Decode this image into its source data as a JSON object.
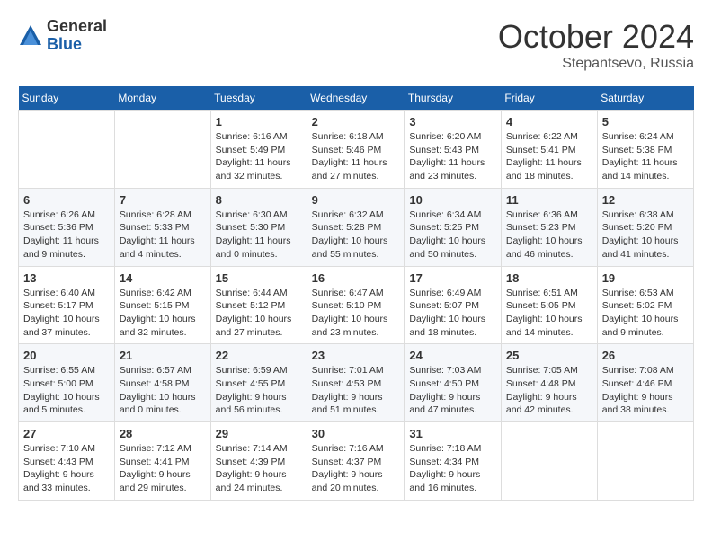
{
  "header": {
    "logo_general": "General",
    "logo_blue": "Blue",
    "month": "October 2024",
    "location": "Stepantsevo, Russia"
  },
  "days_of_week": [
    "Sunday",
    "Monday",
    "Tuesday",
    "Wednesday",
    "Thursday",
    "Friday",
    "Saturday"
  ],
  "weeks": [
    [
      null,
      null,
      {
        "day": 1,
        "sunrise": "6:16 AM",
        "sunset": "5:49 PM",
        "daylight": "11 hours and 32 minutes."
      },
      {
        "day": 2,
        "sunrise": "6:18 AM",
        "sunset": "5:46 PM",
        "daylight": "11 hours and 27 minutes."
      },
      {
        "day": 3,
        "sunrise": "6:20 AM",
        "sunset": "5:43 PM",
        "daylight": "11 hours and 23 minutes."
      },
      {
        "day": 4,
        "sunrise": "6:22 AM",
        "sunset": "5:41 PM",
        "daylight": "11 hours and 18 minutes."
      },
      {
        "day": 5,
        "sunrise": "6:24 AM",
        "sunset": "5:38 PM",
        "daylight": "11 hours and 14 minutes."
      }
    ],
    [
      {
        "day": 6,
        "sunrise": "6:26 AM",
        "sunset": "5:36 PM",
        "daylight": "11 hours and 9 minutes."
      },
      {
        "day": 7,
        "sunrise": "6:28 AM",
        "sunset": "5:33 PM",
        "daylight": "11 hours and 4 minutes."
      },
      {
        "day": 8,
        "sunrise": "6:30 AM",
        "sunset": "5:30 PM",
        "daylight": "11 hours and 0 minutes."
      },
      {
        "day": 9,
        "sunrise": "6:32 AM",
        "sunset": "5:28 PM",
        "daylight": "10 hours and 55 minutes."
      },
      {
        "day": 10,
        "sunrise": "6:34 AM",
        "sunset": "5:25 PM",
        "daylight": "10 hours and 50 minutes."
      },
      {
        "day": 11,
        "sunrise": "6:36 AM",
        "sunset": "5:23 PM",
        "daylight": "10 hours and 46 minutes."
      },
      {
        "day": 12,
        "sunrise": "6:38 AM",
        "sunset": "5:20 PM",
        "daylight": "10 hours and 41 minutes."
      }
    ],
    [
      {
        "day": 13,
        "sunrise": "6:40 AM",
        "sunset": "5:17 PM",
        "daylight": "10 hours and 37 minutes."
      },
      {
        "day": 14,
        "sunrise": "6:42 AM",
        "sunset": "5:15 PM",
        "daylight": "10 hours and 32 minutes."
      },
      {
        "day": 15,
        "sunrise": "6:44 AM",
        "sunset": "5:12 PM",
        "daylight": "10 hours and 27 minutes."
      },
      {
        "day": 16,
        "sunrise": "6:47 AM",
        "sunset": "5:10 PM",
        "daylight": "10 hours and 23 minutes."
      },
      {
        "day": 17,
        "sunrise": "6:49 AM",
        "sunset": "5:07 PM",
        "daylight": "10 hours and 18 minutes."
      },
      {
        "day": 18,
        "sunrise": "6:51 AM",
        "sunset": "5:05 PM",
        "daylight": "10 hours and 14 minutes."
      },
      {
        "day": 19,
        "sunrise": "6:53 AM",
        "sunset": "5:02 PM",
        "daylight": "10 hours and 9 minutes."
      }
    ],
    [
      {
        "day": 20,
        "sunrise": "6:55 AM",
        "sunset": "5:00 PM",
        "daylight": "10 hours and 5 minutes."
      },
      {
        "day": 21,
        "sunrise": "6:57 AM",
        "sunset": "4:58 PM",
        "daylight": "10 hours and 0 minutes."
      },
      {
        "day": 22,
        "sunrise": "6:59 AM",
        "sunset": "4:55 PM",
        "daylight": "9 hours and 56 minutes."
      },
      {
        "day": 23,
        "sunrise": "7:01 AM",
        "sunset": "4:53 PM",
        "daylight": "9 hours and 51 minutes."
      },
      {
        "day": 24,
        "sunrise": "7:03 AM",
        "sunset": "4:50 PM",
        "daylight": "9 hours and 47 minutes."
      },
      {
        "day": 25,
        "sunrise": "7:05 AM",
        "sunset": "4:48 PM",
        "daylight": "9 hours and 42 minutes."
      },
      {
        "day": 26,
        "sunrise": "7:08 AM",
        "sunset": "4:46 PM",
        "daylight": "9 hours and 38 minutes."
      }
    ],
    [
      {
        "day": 27,
        "sunrise": "7:10 AM",
        "sunset": "4:43 PM",
        "daylight": "9 hours and 33 minutes."
      },
      {
        "day": 28,
        "sunrise": "7:12 AM",
        "sunset": "4:41 PM",
        "daylight": "9 hours and 29 minutes."
      },
      {
        "day": 29,
        "sunrise": "7:14 AM",
        "sunset": "4:39 PM",
        "daylight": "9 hours and 24 minutes."
      },
      {
        "day": 30,
        "sunrise": "7:16 AM",
        "sunset": "4:37 PM",
        "daylight": "9 hours and 20 minutes."
      },
      {
        "day": 31,
        "sunrise": "7:18 AM",
        "sunset": "4:34 PM",
        "daylight": "9 hours and 16 minutes."
      },
      null,
      null
    ]
  ],
  "labels": {
    "sunrise": "Sunrise:",
    "sunset": "Sunset:",
    "daylight": "Daylight:"
  }
}
